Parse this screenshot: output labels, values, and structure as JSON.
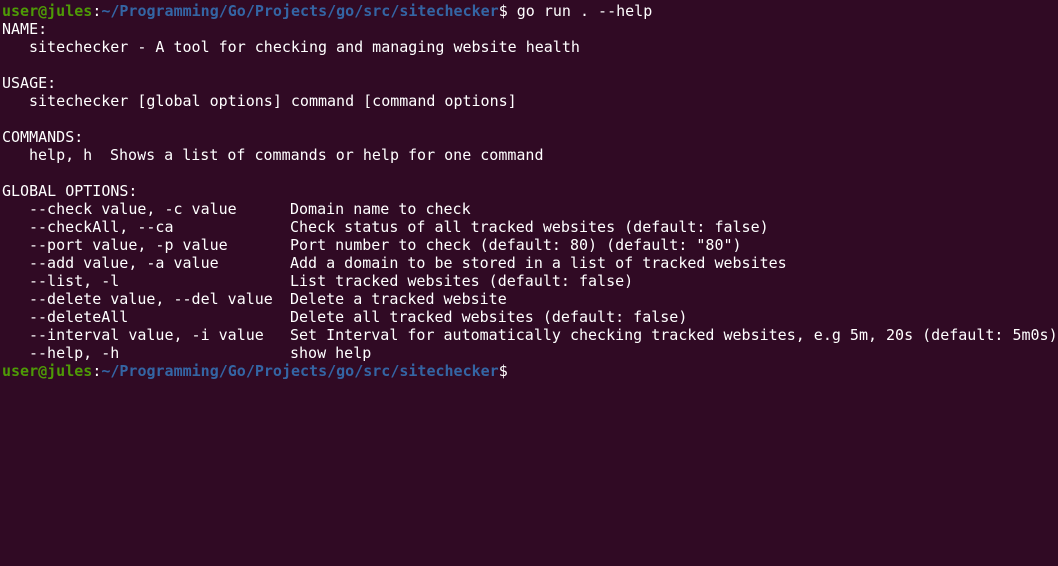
{
  "prompt": {
    "user_host": "user@jules",
    "separator": ":",
    "path": "~/Programming/Go/Projects/go/src/sitechecker",
    "dollar": "$"
  },
  "command_entered": " go run . --help",
  "help": {
    "name_header": "NAME:",
    "name_text": "sitechecker - A tool for checking and managing website health",
    "usage_header": "USAGE:",
    "usage_text": "sitechecker [global options] command [command options]",
    "commands_header": "COMMANDS:",
    "commands": [
      {
        "name": "help, h",
        "desc": "Shows a list of commands or help for one command"
      }
    ],
    "options_header": "GLOBAL OPTIONS:",
    "options": [
      {
        "flag": "--check value, -c value",
        "desc": "Domain name to check"
      },
      {
        "flag": "--checkAll, --ca",
        "desc": "Check status of all tracked websites (default: false)"
      },
      {
        "flag": "--port value, -p value",
        "desc": "Port number to check (default: 80) (default: \"80\")"
      },
      {
        "flag": "--add value, -a value",
        "desc": "Add a domain to be stored in a list of tracked websites"
      },
      {
        "flag": "--list, -l",
        "desc": "List tracked websites (default: false)"
      },
      {
        "flag": "--delete value, --del value",
        "desc": "Delete a tracked website"
      },
      {
        "flag": "--deleteAll",
        "desc": "Delete all tracked websites (default: false)"
      },
      {
        "flag": "--interval value, -i value",
        "desc": "Set Interval for automatically checking tracked websites, e.g 5m, 20s (default: 5m0s)"
      },
      {
        "flag": "--help, -h",
        "desc": "show help"
      }
    ]
  },
  "colors": {
    "background": "#300a24",
    "user_host": "#4e9a06",
    "path": "#3465a4",
    "text": "#ffffff"
  }
}
